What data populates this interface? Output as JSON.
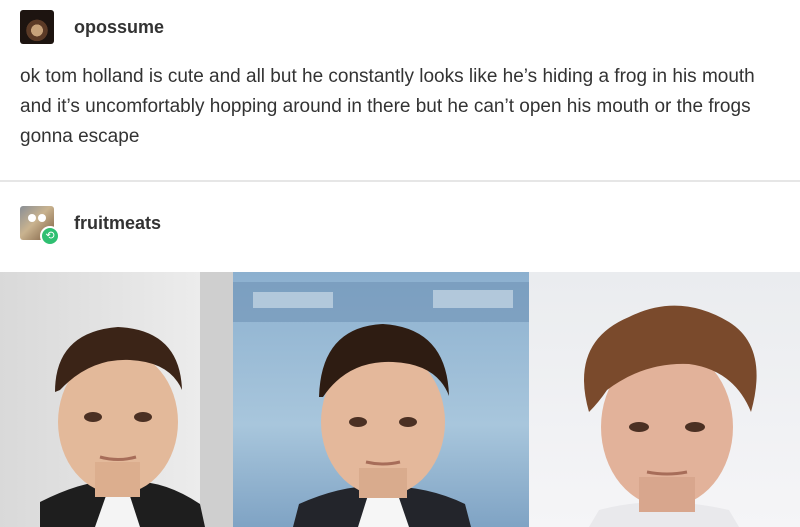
{
  "posts": [
    {
      "username": "opossume",
      "text": "ok tom holland is cute and all but he constantly looks like he’s hiding a frog in his mouth and it’s uncomfortably hopping around in there but he can’t open his mouth or the frogs gonna escape"
    },
    {
      "username": "fruitmeats",
      "reblog_icon": "reblog-icon",
      "photos": [
        {
          "subject": "portrait-photo-1",
          "backdrop": "white-event-backdrop"
        },
        {
          "subject": "portrait-photo-2",
          "backdrop": "spider-man-premiere-backdrop"
        },
        {
          "subject": "portrait-photo-3",
          "backdrop": "plain-light-backdrop"
        }
      ]
    }
  ],
  "colors": {
    "reblog_badge": "#2fbf71",
    "divider": "#e6e6e6",
    "text": "#333333"
  }
}
